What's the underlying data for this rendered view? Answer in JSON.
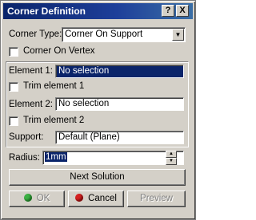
{
  "window": {
    "title": "Corner Definition"
  },
  "titlebar": {
    "help": "?",
    "close": "X"
  },
  "corner_type": {
    "label": "Corner Type:",
    "value": "Corner On Support"
  },
  "corner_on_vertex": {
    "label": "Corner On Vertex",
    "checked": false
  },
  "element1": {
    "label": "Element 1:",
    "value": "No selection"
  },
  "trim_element1": {
    "label": "Trim element 1",
    "checked": false
  },
  "element2": {
    "label": "Element 2:",
    "value": "No selection"
  },
  "trim_element2": {
    "label": "Trim element 2",
    "checked": false
  },
  "support": {
    "label": "Support:",
    "value": "Default (Plane)"
  },
  "radius": {
    "label": "Radius:",
    "value": "1mm"
  },
  "buttons": {
    "next_solution": "Next Solution",
    "ok": "OK",
    "cancel": "Cancel",
    "preview": "Preview"
  },
  "colors": {
    "ok_icon": "#3cb043",
    "cancel_icon": "#d42020",
    "selection": "#0a246a"
  }
}
